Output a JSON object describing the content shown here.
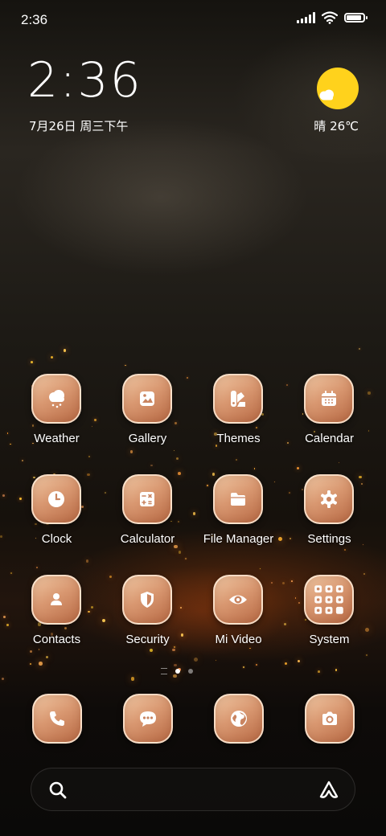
{
  "status_bar": {
    "time": "2:36",
    "battery_level": 0.9
  },
  "clock_widget": {
    "time": "2:36",
    "date": "7月26日 周三下午"
  },
  "weather_widget": {
    "condition_temp": "晴 26℃",
    "icon": "sun-cloud-icon"
  },
  "apps": [
    {
      "label": "Weather",
      "icon": "weather-icon"
    },
    {
      "label": "Gallery",
      "icon": "gallery-icon"
    },
    {
      "label": "Themes",
      "icon": "themes-icon"
    },
    {
      "label": "Calendar",
      "icon": "calendar-icon"
    },
    {
      "label": "Clock",
      "icon": "clock-icon"
    },
    {
      "label": "Calculator",
      "icon": "calculator-icon"
    },
    {
      "label": "File Manager",
      "icon": "folder-icon"
    },
    {
      "label": "Settings",
      "icon": "gear-icon"
    },
    {
      "label": "Contacts",
      "icon": "contacts-icon"
    },
    {
      "label": "Security",
      "icon": "shield-icon"
    },
    {
      "label": "Mi Video",
      "icon": "eye-icon"
    },
    {
      "label": "System",
      "icon": "folder-grid-icon"
    }
  ],
  "dock": [
    {
      "icon": "phone-icon"
    },
    {
      "icon": "message-icon"
    },
    {
      "icon": "browser-icon"
    },
    {
      "icon": "camera-icon"
    }
  ],
  "page_indicator": {
    "pages": 2,
    "current": 1
  },
  "colors": {
    "icon_bg": "#d99871",
    "icon_border": "#ffebd7",
    "sun": "#ffd21c"
  }
}
